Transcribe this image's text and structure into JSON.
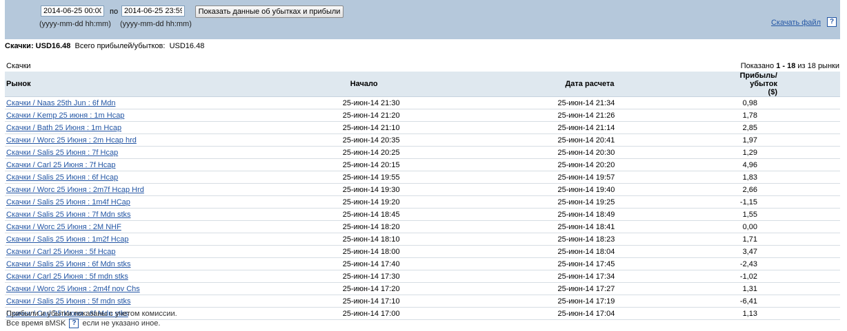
{
  "filter": {
    "from_value": "2014-06-25 00:00",
    "to_label": "по",
    "to_value": "2014-06-25 23:59",
    "show_button": "Показать данные об убытках и прибыли",
    "from_format": "(yyyy-mm-dd hh:mm)",
    "to_format": "(yyyy-mm-dd hh:mm)",
    "download_link": "Скачать файл",
    "help_glyph": "?"
  },
  "summary": {
    "label": "Скачки: USD16.48",
    "total_label": "Всего прибылей/убытков:",
    "total_value": "USD16.48"
  },
  "section_title": "Скачки",
  "pagination": {
    "prefix": "Показано",
    "range": "1 - 18",
    "suffix": "из 18 рынки"
  },
  "table": {
    "headers": [
      "Рынок",
      "Начало",
      "Дата расчета",
      "Прибыль/убыток ($)"
    ],
    "rows": [
      {
        "market": "Скачки / Naas 25th Jun : 6f Mdn",
        "start": "25-июн-14 21:30",
        "settled": "25-июн-14 21:34",
        "pl": "0,98"
      },
      {
        "market": "Скачки / Kemp 25 июня : 1m Hcap",
        "start": "25-июн-14 21:20",
        "settled": "25-июн-14 21:26",
        "pl": "1,78"
      },
      {
        "market": "Скачки / Bath 25 Июня : 1m Hcap",
        "start": "25-июн-14 21:10",
        "settled": "25-июн-14 21:14",
        "pl": "2,85"
      },
      {
        "market": "Скачки / Worc 25 Июня : 2m Hcap hrd",
        "start": "25-июн-14 20:35",
        "settled": "25-июн-14 20:41",
        "pl": "1,97"
      },
      {
        "market": "Скачки / Salis 25 Июня : 7f Hcap",
        "start": "25-июн-14 20:25",
        "settled": "25-июн-14 20:30",
        "pl": "1,29"
      },
      {
        "market": "Скачки / Carl 25 Июня : 7f Hcap",
        "start": "25-июн-14 20:15",
        "settled": "25-июн-14 20:20",
        "pl": "4,96"
      },
      {
        "market": "Скачки / Salis 25 Июня : 6f Hcap",
        "start": "25-июн-14 19:55",
        "settled": "25-июн-14 19:57",
        "pl": "1,83"
      },
      {
        "market": "Скачки / Worc 25 Июня : 2m7f Hcap Hrd",
        "start": "25-июн-14 19:30",
        "settled": "25-июн-14 19:40",
        "pl": "2,66"
      },
      {
        "market": "Скачки / Salis 25 Июня : 1m4f HCap",
        "start": "25-июн-14 19:20",
        "settled": "25-июн-14 19:25",
        "pl": "-1,15"
      },
      {
        "market": "Скачки / Salis 25 Июня : 7f Mdn stks",
        "start": "25-июн-14 18:45",
        "settled": "25-июн-14 18:49",
        "pl": "1,55"
      },
      {
        "market": "Скачки / Worc 25 Июня : 2M NHF",
        "start": "25-июн-14 18:20",
        "settled": "25-июн-14 18:41",
        "pl": "0,00"
      },
      {
        "market": "Скачки / Salis 25 Июня : 1m2f Hcap",
        "start": "25-июн-14 18:10",
        "settled": "25-июн-14 18:23",
        "pl": "1,71"
      },
      {
        "market": "Скачки / Carl 25 Июня : 5f Hcap",
        "start": "25-июн-14 18:00",
        "settled": "25-июн-14 18:04",
        "pl": "3,47"
      },
      {
        "market": "Скачки / Salis 25 Июня : 6f Mdn stks",
        "start": "25-июн-14 17:40",
        "settled": "25-июн-14 17:45",
        "pl": "-2,43"
      },
      {
        "market": "Скачки / Carl 25 Июня : 5f mdn stks",
        "start": "25-июн-14 17:30",
        "settled": "25-июн-14 17:34",
        "pl": "-1,02"
      },
      {
        "market": "Скачки / Worc 25 Июня : 2m4f nov Chs",
        "start": "25-июн-14 17:20",
        "settled": "25-июн-14 17:27",
        "pl": "1,31"
      },
      {
        "market": "Скачки / Salis 25 Июня : 5f mdn stks",
        "start": "25-июн-14 17:10",
        "settled": "25-июн-14 17:19",
        "pl": "-6,41"
      },
      {
        "market": "Скачки / Carl 25 Июня : 6f Mdn stks",
        "start": "25-июн-14 17:00",
        "settled": "25-июн-14 17:04",
        "pl": "1,13"
      }
    ]
  },
  "footer": {
    "note1": "Прибыли и убытки показаны с учетом комиссии.",
    "note2_prefix": "Все время вMSK",
    "note2_suffix": "если не указано иное."
  }
}
